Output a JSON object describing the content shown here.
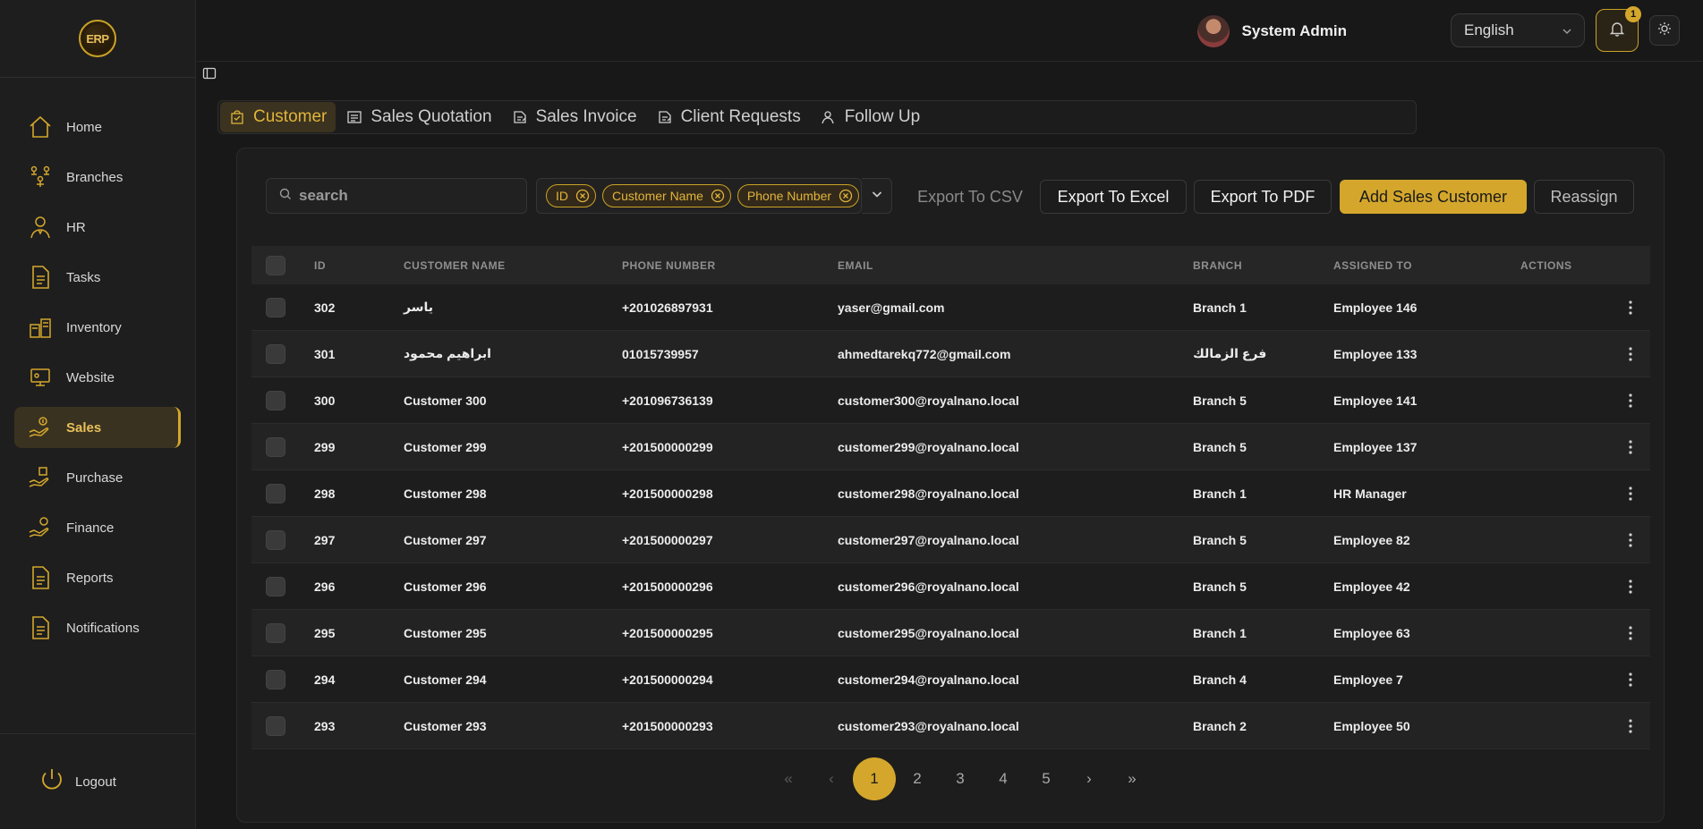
{
  "sidebar": {
    "logo_text": "ERP",
    "items": [
      {
        "label": "Home",
        "icon": "home-icon",
        "active": false
      },
      {
        "label": "Branches",
        "icon": "branches-icon",
        "active": false
      },
      {
        "label": "HR",
        "icon": "hr-icon",
        "active": false
      },
      {
        "label": "Tasks",
        "icon": "tasks-icon",
        "active": false
      },
      {
        "label": "Inventory",
        "icon": "inventory-icon",
        "active": false
      },
      {
        "label": "Website",
        "icon": "website-icon",
        "active": false
      },
      {
        "label": "Sales",
        "icon": "sales-icon",
        "active": true
      },
      {
        "label": "Purchase",
        "icon": "purchase-icon",
        "active": false
      },
      {
        "label": "Finance",
        "icon": "finance-icon",
        "active": false
      },
      {
        "label": "Reports",
        "icon": "reports-icon",
        "active": false
      },
      {
        "label": "Notifications",
        "icon": "notifications-icon",
        "active": false
      }
    ],
    "logout_label": "Logout"
  },
  "header": {
    "user_name": "System Admin",
    "language": "English",
    "notification_count": "1"
  },
  "tabs": [
    {
      "label": "Customer",
      "active": true
    },
    {
      "label": "Sales Quotation",
      "active": false
    },
    {
      "label": "Sales Invoice",
      "active": false
    },
    {
      "label": "Client Requests",
      "active": false
    },
    {
      "label": "Follow Up",
      "active": false
    }
  ],
  "toolbar": {
    "search_placeholder": "search",
    "chips": [
      "ID",
      "Customer Name",
      "Phone Number"
    ],
    "export_csv": "Export To CSV",
    "export_excel": "Export To Excel",
    "export_pdf": "Export To PDF",
    "add_customer": "Add Sales Customer",
    "reassign": "Reassign"
  },
  "table": {
    "columns": [
      "ID",
      "CUSTOMER NAME",
      "PHONE NUMBER",
      "EMAIL",
      "BRANCH",
      "ASSIGNED TO",
      "ACTIONS"
    ],
    "rows": [
      {
        "id": "302",
        "name": "ياسر",
        "phone": "+201026897931",
        "email": "yaser@gmail.com",
        "branch": "Branch 1",
        "assigned": "Employee 146"
      },
      {
        "id": "301",
        "name": "ابراهيم محمود",
        "phone": "01015739957",
        "email": "ahmedtarekq772@gmail.com",
        "branch": "فرع الزمالك",
        "assigned": "Employee 133"
      },
      {
        "id": "300",
        "name": "Customer 300",
        "phone": "+201096736139",
        "email": "customer300@royalnano.local",
        "branch": "Branch 5",
        "assigned": "Employee 141"
      },
      {
        "id": "299",
        "name": "Customer 299",
        "phone": "+201500000299",
        "email": "customer299@royalnano.local",
        "branch": "Branch 5",
        "assigned": "Employee 137"
      },
      {
        "id": "298",
        "name": "Customer 298",
        "phone": "+201500000298",
        "email": "customer298@royalnano.local",
        "branch": "Branch 1",
        "assigned": "HR Manager"
      },
      {
        "id": "297",
        "name": "Customer 297",
        "phone": "+201500000297",
        "email": "customer297@royalnano.local",
        "branch": "Branch 5",
        "assigned": "Employee 82"
      },
      {
        "id": "296",
        "name": "Customer 296",
        "phone": "+201500000296",
        "email": "customer296@royalnano.local",
        "branch": "Branch 5",
        "assigned": "Employee 42"
      },
      {
        "id": "295",
        "name": "Customer 295",
        "phone": "+201500000295",
        "email": "customer295@royalnano.local",
        "branch": "Branch 1",
        "assigned": "Employee 63"
      },
      {
        "id": "294",
        "name": "Customer 294",
        "phone": "+201500000294",
        "email": "customer294@royalnano.local",
        "branch": "Branch 4",
        "assigned": "Employee 7"
      },
      {
        "id": "293",
        "name": "Customer 293",
        "phone": "+201500000293",
        "email": "customer293@royalnano.local",
        "branch": "Branch 2",
        "assigned": "Employee 50"
      }
    ]
  },
  "pagination": {
    "first": "«",
    "prev": "‹",
    "pages": [
      "1",
      "2",
      "3",
      "4",
      "5"
    ],
    "current": "1",
    "next": "›",
    "last": "»"
  },
  "colors": {
    "accent": "#d4a72c",
    "background": "#181818",
    "sidebar": "#1e1e1e"
  }
}
